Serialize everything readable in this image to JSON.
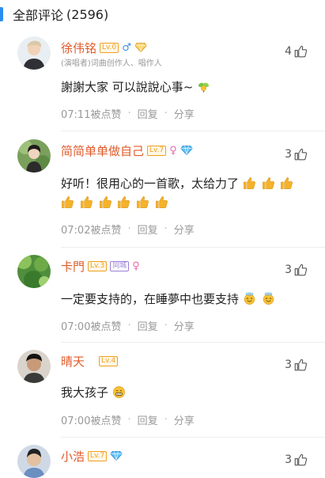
{
  "header": {
    "title": "全部评论",
    "count": "(2596)"
  },
  "comments": [
    {
      "username": "徐伟铭",
      "level": "Lv.0",
      "gender": "♂",
      "subtitle": "(演唱者)词曲创作人、唱作人",
      "likes": "4",
      "content": "謝謝大家  可以說說心事~",
      "time": "07:11被点赞",
      "reply": "回复",
      "share": "分享"
    },
    {
      "username": "简简单单做自己",
      "level": "Lv.7",
      "gender": "♀",
      "likes": "3",
      "content_line1": "好听！很用心的一首歌，太给力了",
      "time": "07:02被点赞",
      "reply": "回复",
      "share": "分享"
    },
    {
      "username": "卡門",
      "level": "Lv.3",
      "badge": "同城",
      "gender": "♀",
      "likes": "3",
      "content": "一定要支持的，在睡夢中也要支持",
      "time": "07:00被点赞",
      "reply": "回复",
      "share": "分享"
    },
    {
      "username": "晴天",
      "level": "Lv.4",
      "likes": "3",
      "content": "我大孩子",
      "time": "07:00被点赞",
      "reply": "回复",
      "share": "分享"
    },
    {
      "username": "小浩",
      "level": "Lv.7",
      "likes": "3"
    }
  ],
  "icons": {
    "like": "thumbs-up-icon",
    "diamond": "diamond-icon"
  },
  "colors": {
    "accent": "#2d8cf0",
    "username": "#e05a2a",
    "level": "#f0a020",
    "meta": "#999999"
  }
}
